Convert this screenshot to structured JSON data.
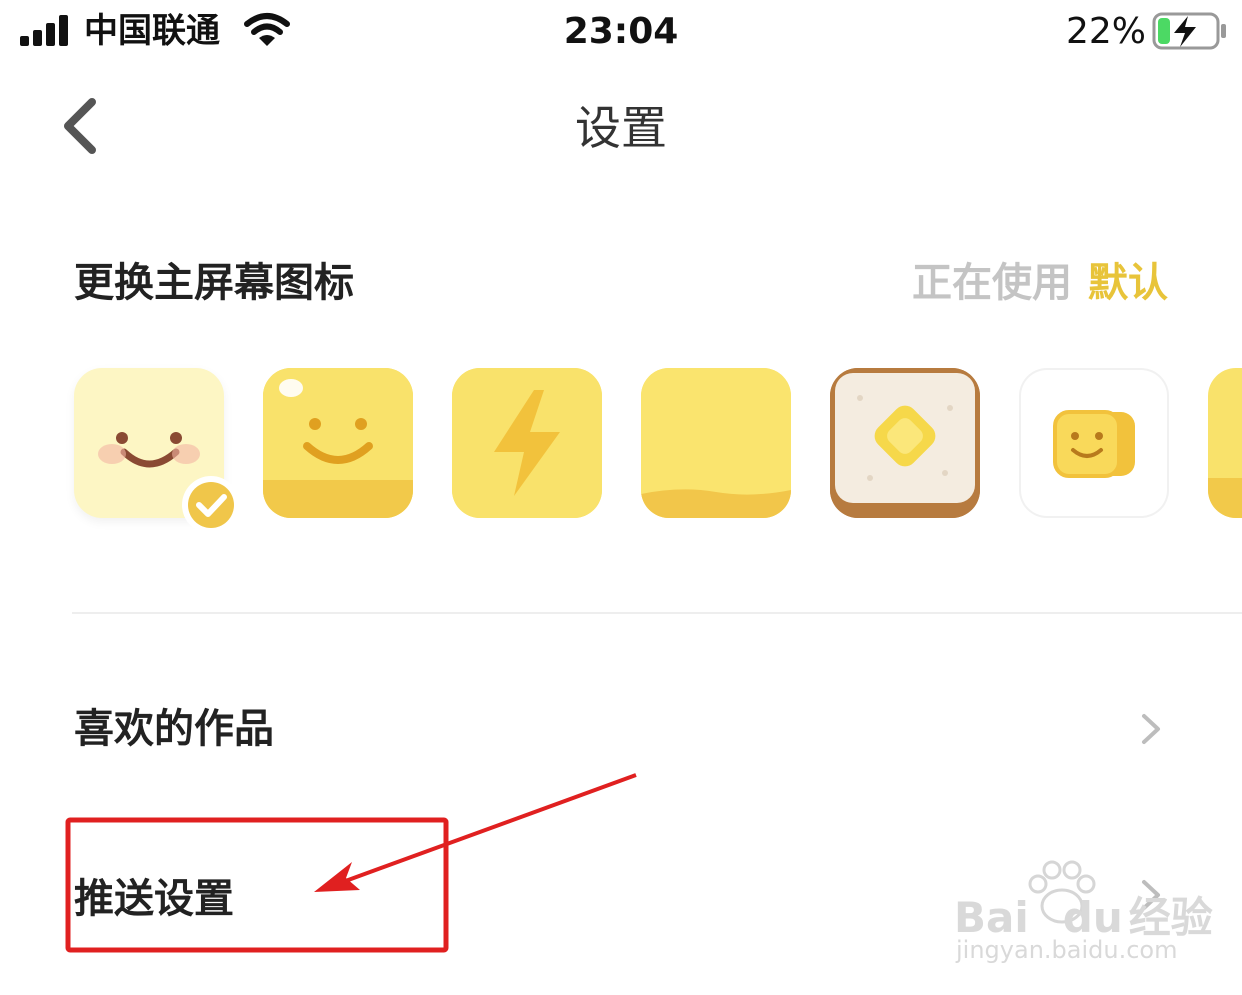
{
  "status_bar": {
    "carrier": "中国联通",
    "time": "23:04",
    "battery": "22%",
    "battery_level": 0.22,
    "signal_icon": "signal-bars-icon",
    "wifi_icon": "wifi-icon",
    "battery_icon": "battery-charging-icon"
  },
  "nav": {
    "title": "设置",
    "back_icon": "chevron-left-icon"
  },
  "icon_section": {
    "label": "更换主屏幕图标",
    "status_prefix": "正在使用",
    "status_value": "默认",
    "accent_color": "#e8c43a",
    "selected_index": 0,
    "icons": [
      {
        "name": "default-smile-icon"
      },
      {
        "name": "yellow-smile-icon"
      },
      {
        "name": "lightning-icon"
      },
      {
        "name": "plain-yellow-icon"
      },
      {
        "name": "toast-butter-icon"
      },
      {
        "name": "yellow-block-smile-icon"
      },
      {
        "name": "partial-yellow-icon"
      }
    ]
  },
  "list": {
    "favorites_label": "喜欢的作品",
    "push_label": "推送设置"
  },
  "annotation": {
    "highlight_color": "#e02020"
  },
  "watermark": {
    "brand": "Bai",
    "brand2": "du",
    "brand_cn": "经验",
    "url": "jingyan.baidu.com"
  }
}
